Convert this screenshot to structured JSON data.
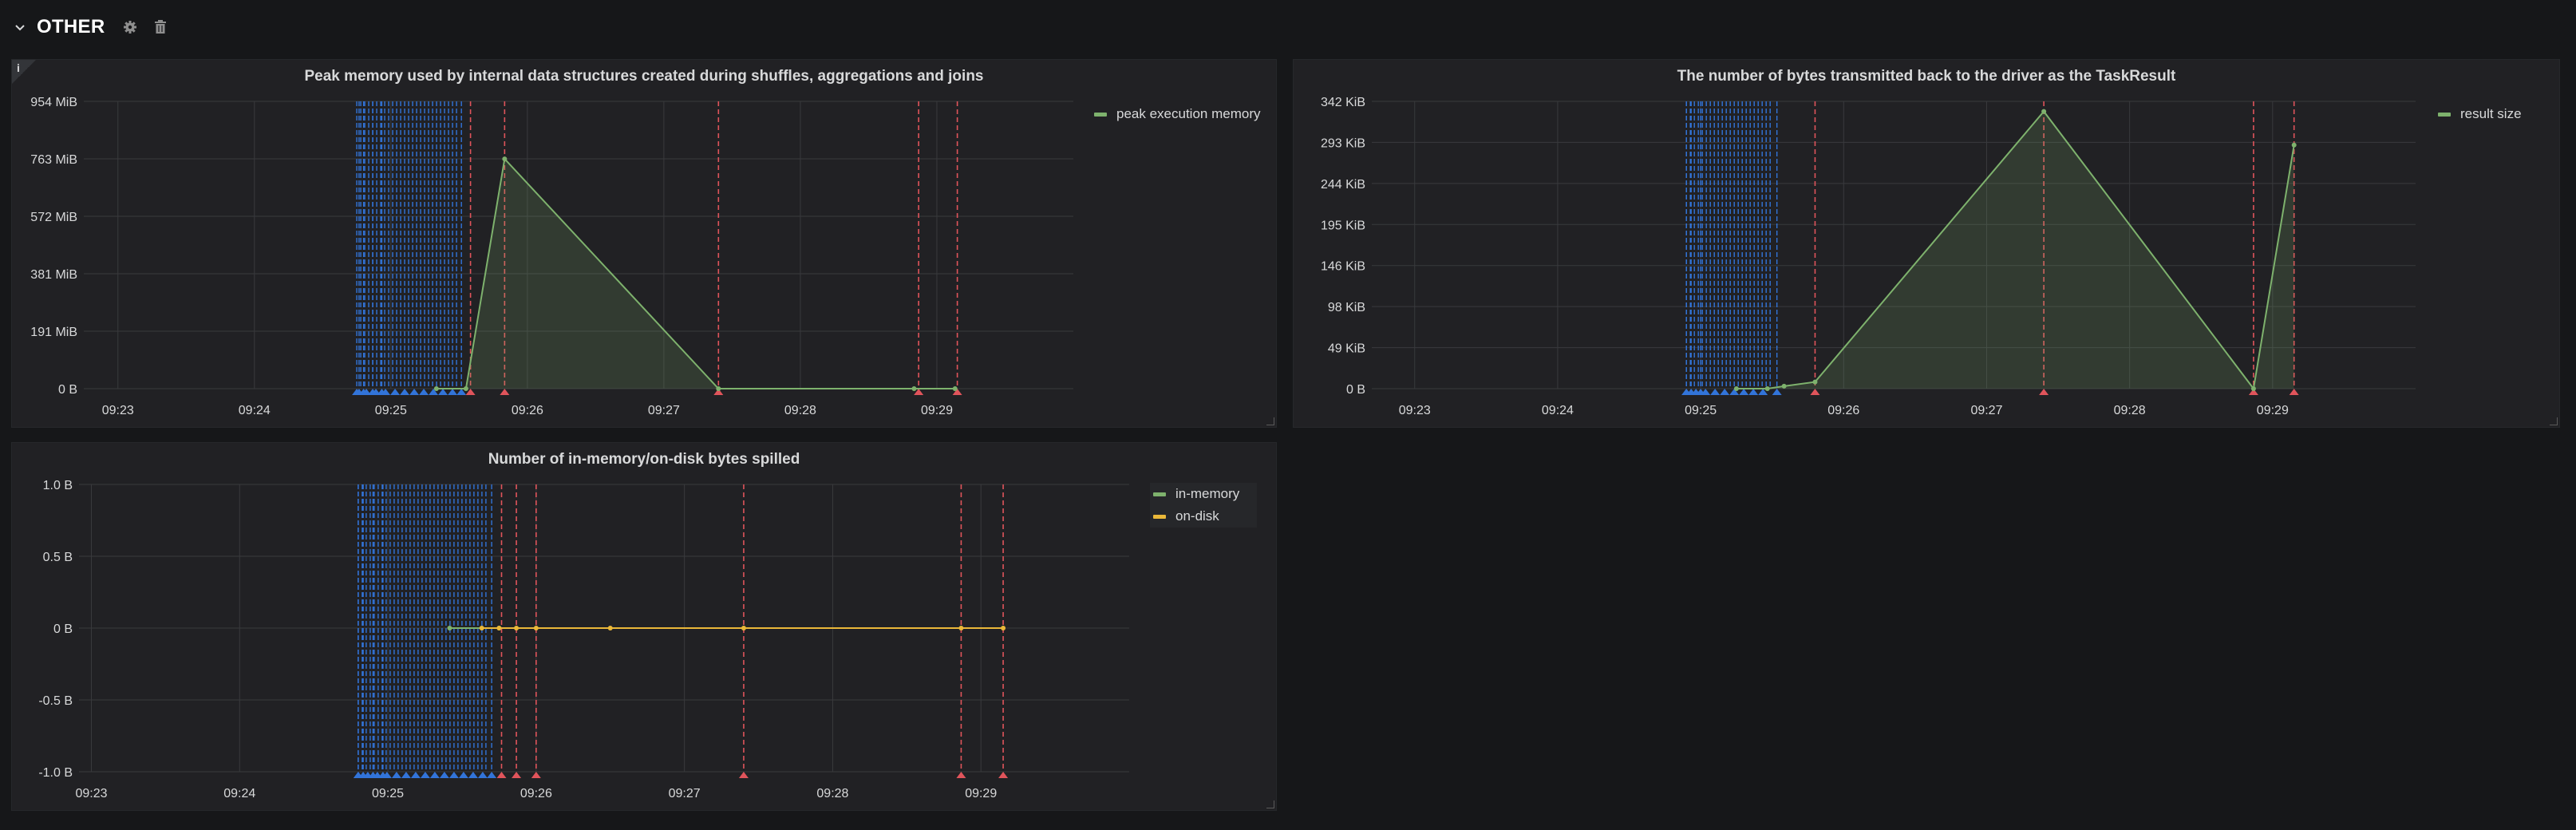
{
  "row": {
    "title": "OTHER",
    "icons": [
      "chevron-down-icon",
      "gear-icon",
      "trash-icon"
    ]
  },
  "colors": {
    "green": "#7eb26d",
    "yellow": "#eab839",
    "annotation_blue": "#3274d9",
    "annotation_red": "#e0545b",
    "grid": "#393a3d",
    "axis_text": "#d8d9da"
  },
  "panels": [
    {
      "id": "peak-memory",
      "title": "Peak memory used by internal data structures created during shuffles, aggregations and joins",
      "info_icon": "i",
      "legend": [
        {
          "label": "peak execution memory",
          "color": "#7eb26d"
        }
      ]
    },
    {
      "id": "result-size",
      "title": "The number of bytes transmitted back to the driver as the TaskResult",
      "legend": [
        {
          "label": "result size",
          "color": "#7eb26d"
        }
      ]
    },
    {
      "id": "bytes-spilled",
      "title": "Number of in-memory/on-disk bytes spilled",
      "legend": [
        {
          "label": "in-memory",
          "color": "#7eb26d"
        },
        {
          "label": "on-disk",
          "color": "#eab839"
        }
      ]
    }
  ],
  "chart_data": [
    {
      "type": "area",
      "title": "Peak memory used by internal data structures created during shuffles, aggregations and joins",
      "x_ticks": [
        "09:23",
        "09:24",
        "09:25",
        "09:26",
        "09:27",
        "09:28",
        "09:29"
      ],
      "y_ticks": [
        "0 B",
        "191 MiB",
        "381 MiB",
        "572 MiB",
        "763 MiB",
        "954 MiB"
      ],
      "y_unit": "MiB",
      "ylim": [
        0,
        954
      ],
      "xlim": [
        "09:22:45",
        "09:30:00"
      ],
      "grid": true,
      "legend_position": "top-right",
      "series": [
        {
          "name": "peak execution memory",
          "color": "#7eb26d",
          "points": [
            [
              "09:25:20",
              0
            ],
            [
              "09:25:33",
              0
            ],
            [
              "09:25:50",
              763
            ],
            [
              "09:27:24",
              0
            ],
            [
              "09:28:50",
              0
            ],
            [
              "09:29:08",
              0
            ]
          ]
        }
      ],
      "annotations": {
        "blue_range": [
          "09:24:45",
          "09:25:30"
        ],
        "blue_lines": [
          "09:24:46",
          "09:24:48",
          "09:24:52",
          "09:24:56",
          "09:25:31"
        ],
        "red_lines": [
          "09:25:35",
          "09:25:50",
          "09:27:24",
          "09:28:52",
          "09:29:09"
        ]
      }
    },
    {
      "type": "area",
      "title": "The number of bytes transmitted back to the driver as the TaskResult",
      "x_ticks": [
        "09:23",
        "09:24",
        "09:25",
        "09:26",
        "09:27",
        "09:28",
        "09:29"
      ],
      "y_ticks": [
        "0 B",
        "49 KiB",
        "98 KiB",
        "146 KiB",
        "195 KiB",
        "244 KiB",
        "293 KiB",
        "342 KiB"
      ],
      "y_unit": "KiB",
      "ylim": [
        0,
        342
      ],
      "xlim": [
        "09:22:42",
        "09:30:00"
      ],
      "grid": true,
      "legend_position": "top-right",
      "series": [
        {
          "name": "result size",
          "color": "#7eb26d",
          "points": [
            [
              "09:25:15",
              0
            ],
            [
              "09:25:28",
              0
            ],
            [
              "09:25:35",
              3
            ],
            [
              "09:25:48",
              8
            ],
            [
              "09:27:24",
              330
            ],
            [
              "09:28:52",
              0
            ],
            [
              "09:29:09",
              290
            ]
          ]
        }
      ],
      "annotations": {
        "blue_range": [
          "09:24:54",
          "09:25:30"
        ],
        "blue_lines": [
          "09:24:54",
          "09:24:56",
          "09:25:00",
          "09:25:32"
        ],
        "red_lines": [
          "09:25:48",
          "09:27:24",
          "09:28:52",
          "09:29:09"
        ]
      }
    },
    {
      "type": "line",
      "title": "Number of in-memory/on-disk bytes spilled",
      "x_ticks": [
        "09:23",
        "09:24",
        "09:25",
        "09:26",
        "09:27",
        "09:28",
        "09:29"
      ],
      "y_ticks": [
        "-1.0 B",
        "-0.5 B",
        "0 B",
        "0.5 B",
        "1.0 B"
      ],
      "ylim": [
        -1,
        1
      ],
      "xlim": [
        "09:22:55",
        "09:30:00"
      ],
      "grid": true,
      "legend_position": "top-right",
      "series": [
        {
          "name": "in-memory",
          "color": "#7eb26d",
          "points": [
            [
              "09:25:25",
              0
            ],
            [
              "09:25:45",
              0
            ]
          ]
        },
        {
          "name": "on-disk",
          "color": "#eab839",
          "points": [
            [
              "09:25:38",
              0
            ],
            [
              "09:25:45",
              0
            ],
            [
              "09:25:52",
              0
            ],
            [
              "09:26:00",
              0
            ],
            [
              "09:26:30",
              0
            ],
            [
              "09:27:24",
              0
            ],
            [
              "09:28:52",
              0
            ],
            [
              "09:29:09",
              0
            ]
          ]
        }
      ],
      "annotations": {
        "blue_range": [
          "09:24:48",
          "09:25:40"
        ],
        "blue_lines": [
          "09:24:48",
          "09:24:50",
          "09:24:54",
          "09:24:58",
          "09:25:42"
        ],
        "red_lines": [
          "09:25:46",
          "09:25:52",
          "09:26:00",
          "09:27:24",
          "09:28:52",
          "09:29:09"
        ]
      }
    }
  ]
}
